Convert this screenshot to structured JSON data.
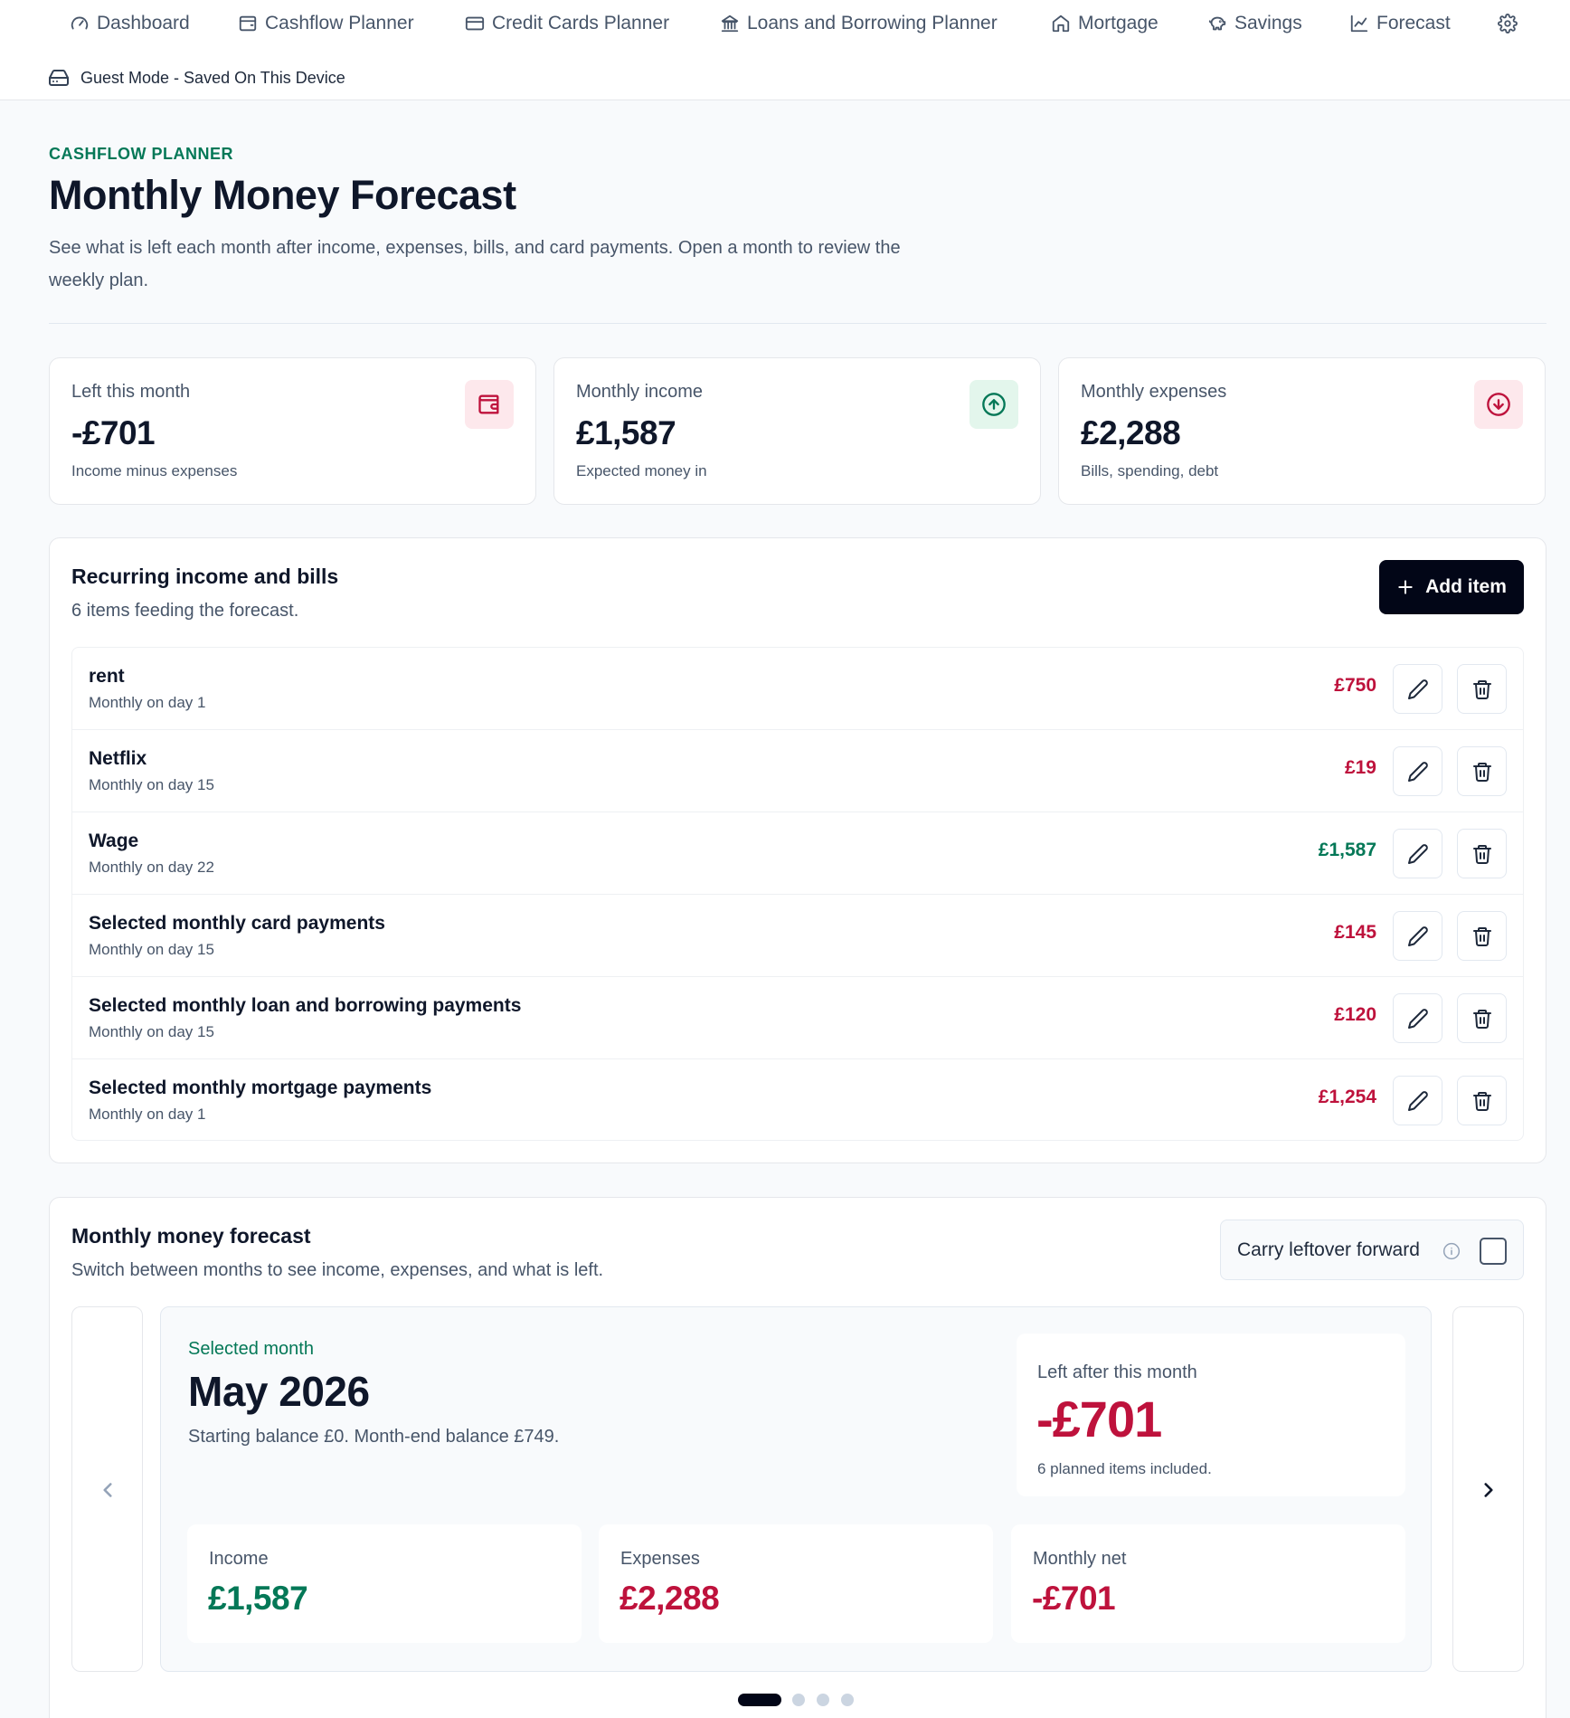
{
  "nav": {
    "items": [
      {
        "label": "Dashboard",
        "icon": "gauge-icon"
      },
      {
        "label": "Cashflow Planner",
        "icon": "wallet-icon"
      },
      {
        "label": "Credit Cards Planner",
        "icon": "credit-card-icon"
      },
      {
        "label": "Loans and Borrowing Planner",
        "icon": "bank-icon"
      },
      {
        "label": "Mortgage",
        "icon": "house-icon"
      },
      {
        "label": "Savings",
        "icon": "piggy-bank-icon"
      },
      {
        "label": "Forecast",
        "icon": "line-chart-icon"
      }
    ],
    "settings_icon": "gear-icon",
    "guest_label": "Guest Mode - Saved On This Device",
    "guest_icon": "hard-drive-icon"
  },
  "header": {
    "eyebrow": "CASHFLOW PLANNER",
    "title": "Monthly Money Forecast",
    "description": "See what is left each month after income, expenses, bills, and card payments. Open a month to review the weekly plan."
  },
  "stats": [
    {
      "label": "Left this month",
      "value": "-£701",
      "sub": "Income minus expenses",
      "icon": "wallet-icon",
      "tone": "red"
    },
    {
      "label": "Monthly income",
      "value": "£1,587",
      "sub": "Expected money in",
      "icon": "arrow-up-circle-icon",
      "tone": "green"
    },
    {
      "label": "Monthly expenses",
      "value": "£2,288",
      "sub": "Bills, spending, debt",
      "icon": "arrow-down-circle-icon",
      "tone": "red"
    }
  ],
  "recurring": {
    "title": "Recurring income and bills",
    "subtitle": "6 items feeding the forecast.",
    "add_label": "Add item",
    "items": [
      {
        "name": "rent",
        "schedule": "Monthly on day 1",
        "amount": "£750",
        "type": "expense"
      },
      {
        "name": "Netflix",
        "schedule": "Monthly on day 15",
        "amount": "£19",
        "type": "expense"
      },
      {
        "name": "Wage",
        "schedule": "Monthly on day 22",
        "amount": "£1,587",
        "type": "income"
      },
      {
        "name": "Selected monthly card payments",
        "schedule": "Monthly on day 15",
        "amount": "£145",
        "type": "expense"
      },
      {
        "name": "Selected monthly loan and borrowing payments",
        "schedule": "Monthly on day 15",
        "amount": "£120",
        "type": "expense"
      },
      {
        "name": "Selected monthly mortgage payments",
        "schedule": "Monthly on day 1",
        "amount": "£1,254",
        "type": "expense"
      }
    ]
  },
  "forecast": {
    "title": "Monthly money forecast",
    "subtitle": "Switch between months to see income, expenses, and what is left.",
    "carry_label": "Carry leftover forward",
    "carry_checked": false,
    "selected_label": "Selected month",
    "month": "May 2026",
    "month_desc": "Starting balance £0. Month-end balance £749.",
    "left_label": "Left after this month",
    "left_value": "-£701",
    "left_sub": "6 planned items included.",
    "income_label": "Income",
    "income_value": "£1,587",
    "expenses_label": "Expenses",
    "expenses_value": "£2,288",
    "net_label": "Monthly net",
    "net_value": "-£701",
    "page_count": 4,
    "active_page": 1
  },
  "colors": {
    "accent_green": "#047857",
    "accent_red": "#be123c",
    "primary_button": "#020617"
  }
}
